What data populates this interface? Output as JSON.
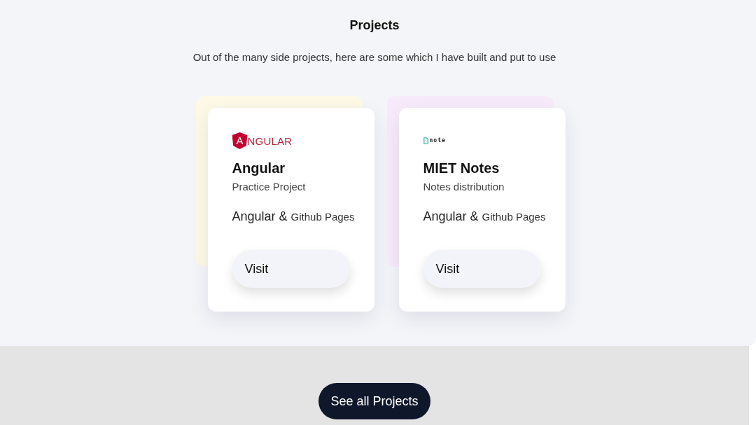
{
  "section": {
    "title": "Projects",
    "subtitle": "Out of the many side projects, here are some which I have built and put to use"
  },
  "projects": [
    {
      "logo": {
        "kind": "shield",
        "mark": "A",
        "text": "NGULAR"
      },
      "name": "Angular",
      "description": "Practice Project",
      "stack": "Angular &",
      "host": "Github Pages",
      "color": "#fdf9e6",
      "button": "Visit"
    },
    {
      "logo": {
        "kind": "page",
        "text": "note"
      },
      "name": "MIET Notes",
      "description": "Notes distribution",
      "stack": "Angular &",
      "host": "Github Pages",
      "color": "#f7ebfb",
      "button": "Visit"
    }
  ],
  "footer_button": "See all Projects"
}
